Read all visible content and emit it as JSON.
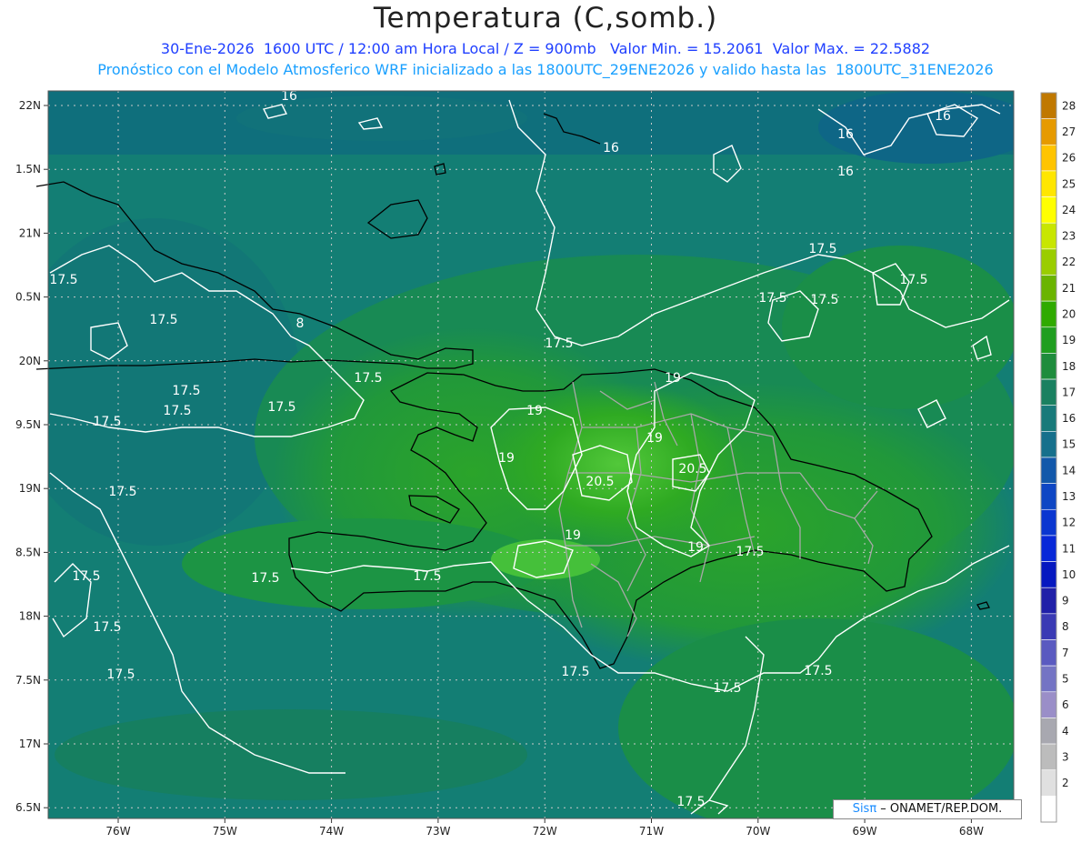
{
  "title": "Temperatura (C,somb.)",
  "subtitle_line1": "30-Ene-2026  1600 UTC / 12:00 am Hora Local / Z = 900mb   Valor Min. = 15.2061  Valor Max. = 22.5882",
  "subtitle_line2": "Pronóstico con el Modelo Atmosferico WRF inicializado a las 1800UTC_29ENE2026 y valido hasta las  1800UTC_31ENE2026",
  "credit_sis": "Sisπ",
  "credit_rest": " – ONAMET/REP.DOM.",
  "lat_labels": [
    "22N",
    "1.5N",
    "21N",
    "0.5N",
    "20N",
    "9.5N",
    "19N",
    "8.5N",
    "18N",
    "7.5N",
    "17N",
    "6.5N"
  ],
  "lon_labels": [
    "76W",
    "75W",
    "74W",
    "73W",
    "72W",
    "71W",
    "70W",
    "69W",
    "68W"
  ],
  "contour_labels": [
    {
      "text": "16"
    },
    {
      "text": "16"
    },
    {
      "text": "16"
    },
    {
      "text": "16"
    },
    {
      "text": "16"
    },
    {
      "text": "17.5"
    },
    {
      "text": "17.5"
    },
    {
      "text": "17.5"
    },
    {
      "text": "17.5"
    },
    {
      "text": "17.5"
    },
    {
      "text": "17.5"
    },
    {
      "text": "17.5"
    },
    {
      "text": "17.5"
    },
    {
      "text": "17.5"
    },
    {
      "text": "17.5"
    },
    {
      "text": "17.5"
    },
    {
      "text": "17.5"
    },
    {
      "text": "17.5"
    },
    {
      "text": "17.5"
    },
    {
      "text": "17.5"
    },
    {
      "text": "17.5"
    },
    {
      "text": "17.5"
    },
    {
      "text": "17.5"
    },
    {
      "text": "17.5"
    },
    {
      "text": "17.5"
    },
    {
      "text": "17.5"
    },
    {
      "text": "17.5"
    },
    {
      "text": "17.5"
    },
    {
      "text": "19"
    },
    {
      "text": "19"
    },
    {
      "text": "19"
    },
    {
      "text": "19"
    },
    {
      "text": "19"
    },
    {
      "text": "19"
    },
    {
      "text": "20.5"
    },
    {
      "text": "20.5"
    },
    {
      "text": "8"
    }
  ],
  "legend": {
    "labels": [
      "28",
      "27",
      "26",
      "25",
      "24",
      "23",
      "22",
      "21",
      "20",
      "19",
      "18",
      "17",
      "16",
      "15",
      "14",
      "13",
      "12",
      "11",
      "10",
      "9",
      "8",
      "7",
      "5",
      "6",
      "4",
      "3",
      "2"
    ],
    "colors": [
      "#c07800",
      "#e69a00",
      "#ffc400",
      "#ffe600",
      "#ffff00",
      "#c8e600",
      "#9acd00",
      "#6ab400",
      "#2faa00",
      "#1f9e1f",
      "#1e8c3c",
      "#1a8060",
      "#187a7a",
      "#16708c",
      "#1258aa",
      "#0e46c4",
      "#0a36d0",
      "#0828d8",
      "#0618c0",
      "#2020a8",
      "#3a3ab4",
      "#5a5ac0",
      "#7474c4",
      "#9a8ec8",
      "#a8a8b0",
      "#bcbcbc",
      "#e0e0e0",
      "#ffffff"
    ]
  },
  "colors": {
    "ocean": "#0f7a78",
    "land": "#1f9e2e",
    "warm": "#3cb82a",
    "contour": "#ffffff",
    "coast": "#000000",
    "province": "#a0a0a0"
  }
}
